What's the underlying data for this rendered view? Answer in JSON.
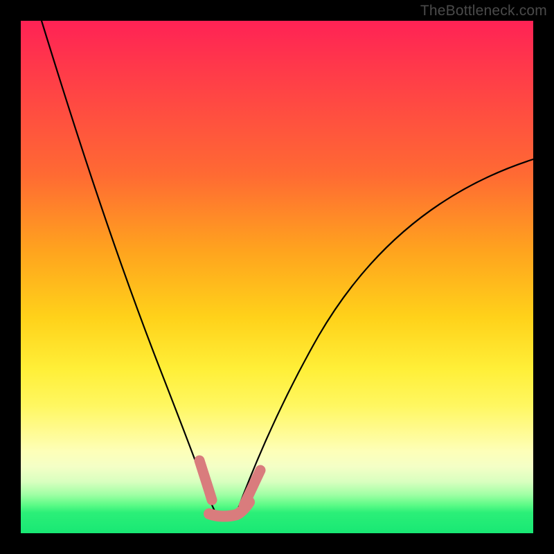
{
  "watermark": "TheBottleneck.com",
  "chart_data": {
    "type": "line",
    "title": "",
    "xlabel": "",
    "ylabel": "",
    "xlim": [
      0,
      100
    ],
    "ylim": [
      0,
      100
    ],
    "series": [
      {
        "name": "left-curve",
        "x": [
          4,
          6,
          8,
          10,
          12,
          14,
          16,
          18,
          20,
          22,
          24,
          26,
          28,
          30,
          32,
          34,
          35.5,
          37
        ],
        "y": [
          100,
          87,
          76,
          66,
          57,
          49,
          42,
          36,
          30,
          25,
          21,
          17,
          13.5,
          10.5,
          8,
          6,
          4.5,
          3.5
        ]
      },
      {
        "name": "valley-floor",
        "x": [
          37,
          38,
          39,
          40,
          41,
          42
        ],
        "y": [
          3.5,
          3.2,
          3.1,
          3.1,
          3.2,
          3.3
        ]
      },
      {
        "name": "right-curve",
        "x": [
          42,
          44,
          48,
          52,
          56,
          60,
          64,
          68,
          72,
          76,
          80,
          84,
          88,
          92,
          96,
          100
        ],
        "y": [
          3.3,
          5,
          10,
          16,
          22,
          28,
          33.5,
          39,
          44,
          49,
          53.5,
          58,
          62,
          66,
          69.5,
          73
        ]
      },
      {
        "name": "highlight-left",
        "x": [
          34,
          35,
          36,
          37,
          37.5
        ],
        "y": [
          12,
          10,
          8.5,
          7,
          6
        ]
      },
      {
        "name": "highlight-bottom",
        "x": [
          37,
          38,
          39,
          40,
          41,
          42,
          43,
          44
        ],
        "y": [
          4,
          3.5,
          3.3,
          3.2,
          3.3,
          3.5,
          4,
          5
        ]
      },
      {
        "name": "highlight-right",
        "x": [
          44,
          45,
          46,
          47
        ],
        "y": [
          5.5,
          7,
          8.5,
          10
        ]
      }
    ],
    "gradient_stops": [
      {
        "pos": 0,
        "band": "red"
      },
      {
        "pos": 65,
        "band": "yellow"
      },
      {
        "pos": 88,
        "band": "pale-yellow"
      },
      {
        "pos": 100,
        "band": "green"
      }
    ]
  }
}
